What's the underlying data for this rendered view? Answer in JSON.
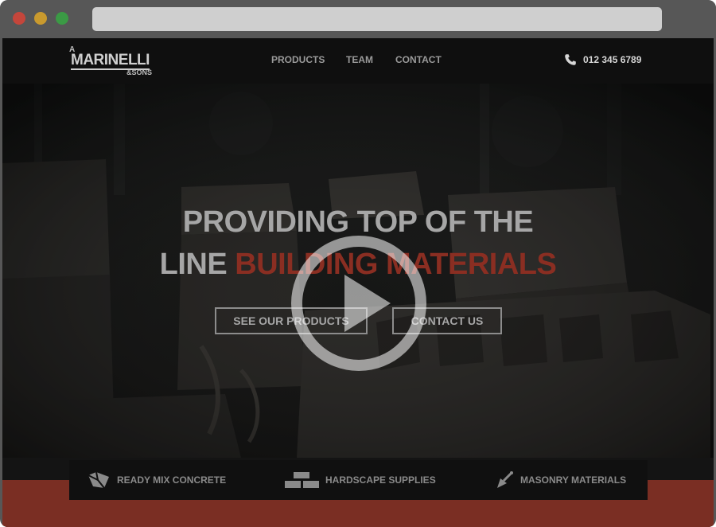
{
  "logo": {
    "top_letter": "A",
    "main": "MARINELLI",
    "sub": "&SONS"
  },
  "nav": {
    "items": [
      {
        "label": "PRODUCTS"
      },
      {
        "label": "TEAM"
      },
      {
        "label": "CONTACT"
      }
    ]
  },
  "phone": {
    "number": "012 345 6789",
    "icon": "phone-icon"
  },
  "hero": {
    "title_line1": "PROVIDING TOP OF THE",
    "title_line2_plain": "LINE",
    "title_line2_accent": "BUILDING MATERIALS",
    "primary_button": "SEE OUR PRODUCTS",
    "secondary_button": "CONTACT US",
    "video_icon": "play-icon"
  },
  "features": {
    "items": [
      {
        "label": "READY MIX CONCRETE",
        "icon": "concrete-icon"
      },
      {
        "label": "HARDSCAPE SUPPLIES",
        "icon": "bricks-icon"
      },
      {
        "label": "MASONRY MATERIALS",
        "icon": "trowel-icon"
      }
    ]
  },
  "colors": {
    "accent_red": "#8a2e22",
    "band_red": "#7a2e23",
    "nav_bg": "#0f0f0f",
    "browser_chrome": "#575757"
  }
}
